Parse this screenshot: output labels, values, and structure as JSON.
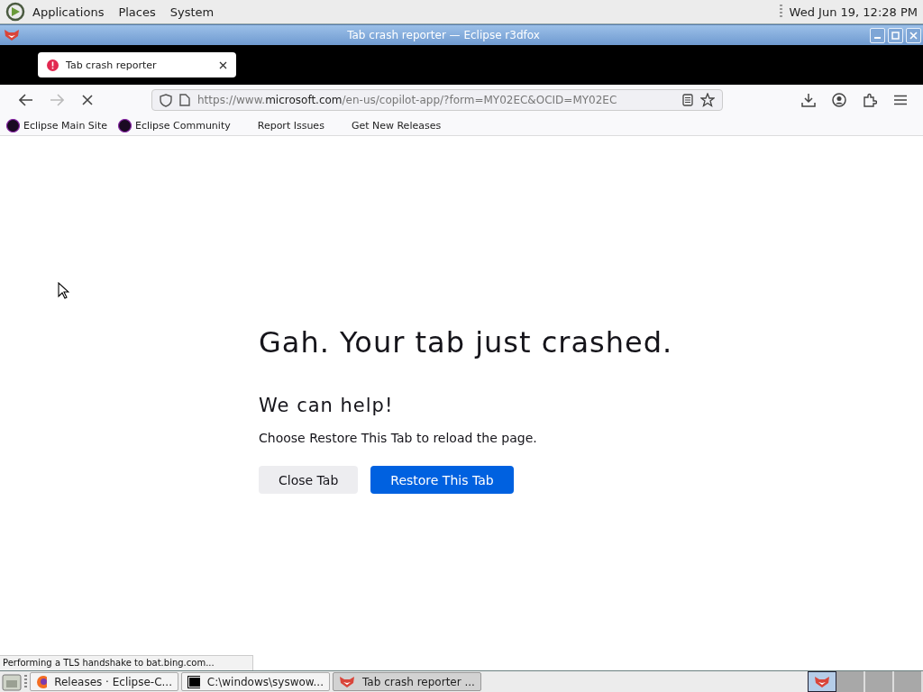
{
  "top_panel": {
    "menus": [
      "Applications",
      "Places",
      "System"
    ],
    "clock": "Wed Jun 19, 12:28 PM"
  },
  "window": {
    "title": "Tab crash reporter — Eclipse r3dfox"
  },
  "tabs": [
    {
      "label": "Tab crash reporter",
      "selected": true
    }
  ],
  "address_bar": {
    "url_start": "https://www.",
    "url_domain": "microsoft.com",
    "url_end": "/en-us/copilot-app/?form=MY02EC&OCID=MY02EC"
  },
  "bookmarks": [
    {
      "label": "Eclipse Main Site",
      "kind": "favicon"
    },
    {
      "label": "Eclipse Community",
      "kind": "favicon"
    },
    {
      "label": "Report Issues",
      "kind": "plain"
    },
    {
      "label": "Get New Releases",
      "kind": "plain"
    }
  ],
  "page": {
    "heading": "Gah. Your tab just crashed.",
    "subheading": "We can help!",
    "message": "Choose Restore This Tab to reload the page.",
    "buttons": [
      {
        "label": "Close Tab",
        "kind": "secondary"
      },
      {
        "label": "Restore This Tab",
        "kind": "primary"
      }
    ]
  },
  "status_text": "Performing a TLS handshake to bat.bing.com...",
  "taskbar": {
    "tasks": [
      {
        "label": "Releases · Eclipse-C...",
        "kind": "firefox",
        "selected": false
      },
      {
        "label": "C:\\windows\\syswow...",
        "kind": "archiver",
        "selected": false
      },
      {
        "label": "Tab crash reporter ...",
        "kind": "fox",
        "selected": true
      }
    ],
    "workspaces": [
      {
        "selected": true
      },
      {
        "selected": false
      },
      {
        "selected": false
      },
      {
        "selected": false
      }
    ]
  }
}
